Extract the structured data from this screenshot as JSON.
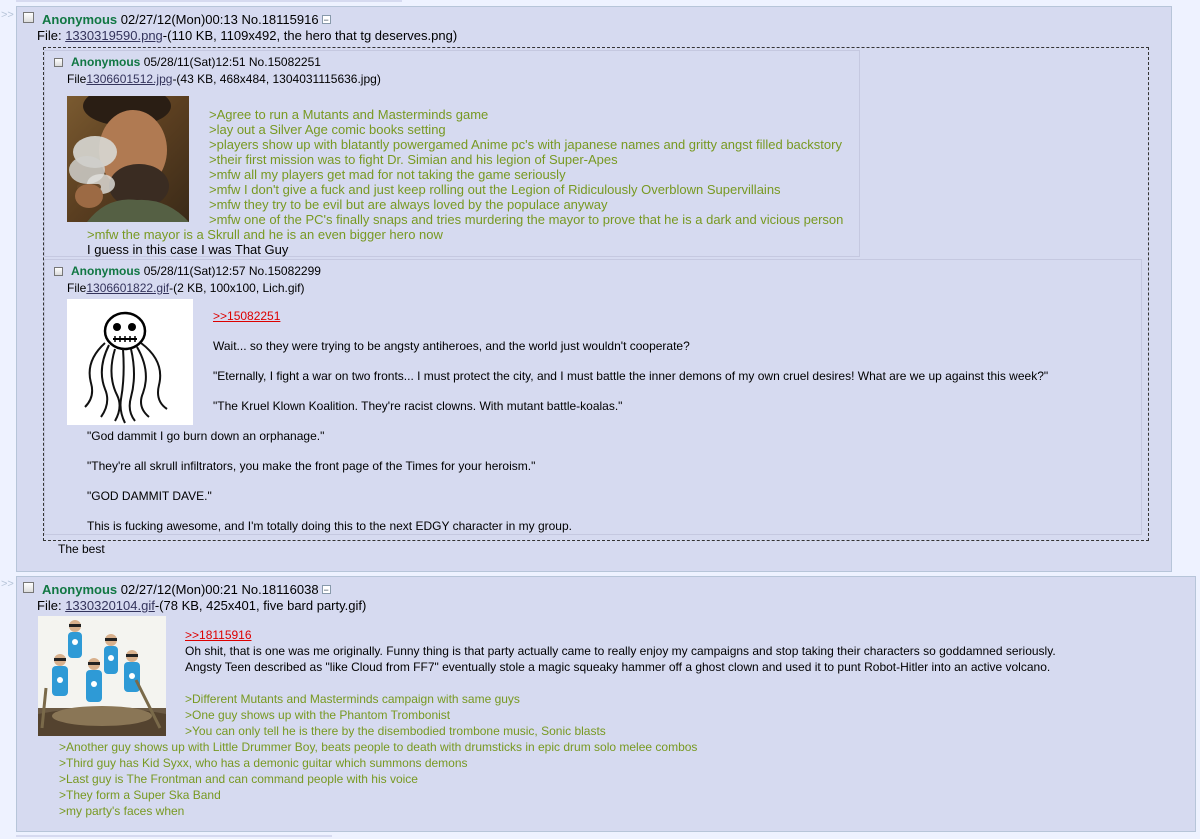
{
  "separators": {
    "top": ">>",
    "bottom": ">>"
  },
  "post1": {
    "name": "Anonymous",
    "date": "02/27/12(Mon)00:13",
    "number": "No.18115916",
    "file_label": "File:",
    "file_link": "1330319590.png",
    "file_info": "-(110 KB, 1109x492, the hero that tg deserves.png)",
    "quoted_a": {
      "name": "Anonymous",
      "date": "05/28/11(Sat)12:51",
      "number": "No.15082251",
      "file_label": "File",
      "file_link": "1306601512.jpg",
      "file_info": "-(43 KB, 468x484, 1304031115636.jpg)",
      "lines": [
        ">Agree to run a Mutants and Masterminds game",
        ">lay out a Silver Age comic books setting",
        ">players show up with blatantly powergamed Anime pc's with japanese names and gritty angst filled backstory",
        ">their first mission was to fight Dr. Simian and his legion of Super-Apes",
        ">mfw all my players get mad for not taking the game seriously",
        ">mfw I don't give a fuck and just keep rolling out the Legion of Ridiculously Overblown Supervillains",
        ">mfw they try to be evil but are always loved by the populace anyway",
        ">mfw one of the PC's finally snaps and tries murdering the mayor to prove that he is a dark and vicious person",
        ">mfw the mayor is a Skrull and he is an even bigger hero now",
        "I guess in this case I was That Guy"
      ]
    },
    "quoted_b": {
      "name": "Anonymous",
      "date": "05/28/11(Sat)12:57",
      "number": "No.15082299",
      "file_label": "File",
      "file_link": "1306601822.gif",
      "file_info": "-(2 KB, 100x100, Lich.gif)",
      "quotelink": ">>15082251",
      "lines": [
        "Wait... so they were trying to be angsty antiheroes, and the world just wouldn't cooperate?",
        "\"Eternally, I fight a war on two fronts... I must protect the city, and I must battle the inner demons of my own cruel desires! What are we up against this week?\"",
        "\"The Kruel Klown Koalition. They're racist clowns. With mutant battle-koalas.\"",
        "\"God dammit I go burn down an orphanage.\"",
        "\"They're all skrull infiltrators, you make the front page of the Times for your heroism.\"",
        "\"GOD DAMMIT DAVE.\"",
        "This is fucking awesome, and I'm totally doing this to the next EDGY character in my group."
      ]
    },
    "comment": "The best"
  },
  "post2": {
    "name": "Anonymous",
    "date": "02/27/12(Mon)00:21",
    "number": "No.18116038",
    "file_label": "File:",
    "file_link": "1330320104.gif",
    "file_info": "-(78 KB, 425x401, five bard party.gif)",
    "quotelink": ">>18115916",
    "lines": [
      "Oh shit, that is one was me originally. Funny thing is that party actually came to really enjoy my campaigns and stop taking their characters so goddamned seriously.",
      "Angsty Teen described as \"like Cloud from FF7\" eventually stole a magic squeaky hammer off a ghost clown and used it to punt Robot-Hitler into an active volcano."
    ],
    "greentext": [
      ">Different Mutants and Masterminds campaign with same guys",
      ">One guy shows up with the Phantom Trombonist",
      ">You can only tell he is there by the disembodied trombone music, Sonic blasts",
      ">Another guy shows up with Little Drummer Boy, beats people to death with drumsticks in epic drum solo melee combos",
      ">Third guy has Kid Syxx, who has a demonic guitar which summons demons",
      ">Last guy is The Frontman and can command people with his voice",
      ">They form a Super Ska Band",
      ">my party's faces when"
    ]
  },
  "colors": {
    "background": "#eef2ff",
    "reply_bg": "#d6daf0",
    "name": "#117743",
    "greentext": "#789922",
    "quotelink": "#dd0000"
  }
}
